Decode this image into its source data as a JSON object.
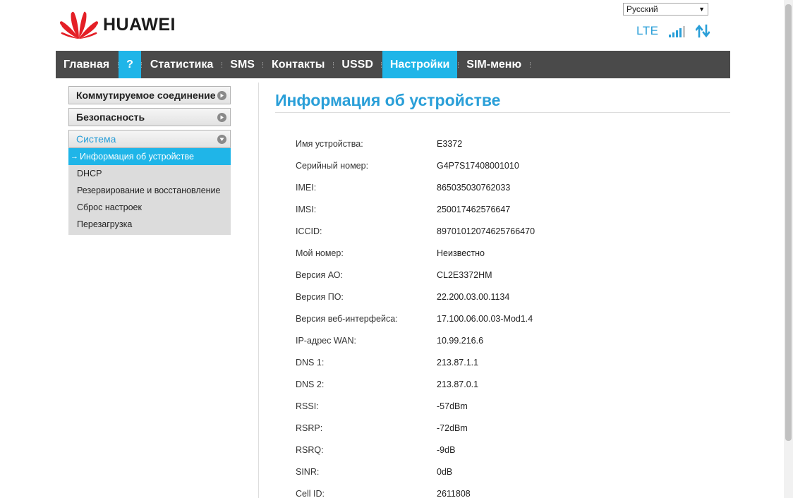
{
  "header": {
    "brand": "HUAWEI",
    "language": "Русский",
    "network": "LTE"
  },
  "nav": [
    {
      "label": "Главная",
      "name": "nav-home",
      "active": false
    },
    {
      "label": "?",
      "name": "nav-help",
      "active": true
    },
    {
      "label": "Статистика",
      "name": "nav-statistics",
      "active": false
    },
    {
      "label": "SMS",
      "name": "nav-sms",
      "active": false
    },
    {
      "label": "Контакты",
      "name": "nav-contacts",
      "active": false
    },
    {
      "label": "USSD",
      "name": "nav-ussd",
      "active": false
    },
    {
      "label": "Настройки",
      "name": "nav-settings",
      "active": true
    },
    {
      "label": "SIM-меню",
      "name": "nav-sim-menu",
      "active": false
    }
  ],
  "sidebar": {
    "sections": [
      {
        "label": "Коммутируемое соединение"
      },
      {
        "label": "Безопасность"
      },
      {
        "label": "Система"
      }
    ],
    "items": [
      {
        "label": "Информация об устройстве",
        "active": true
      },
      {
        "label": "DHCP",
        "active": false
      },
      {
        "label": "Резервирование и восстановление",
        "active": false
      },
      {
        "label": "Сброс настроек",
        "active": false
      },
      {
        "label": "Перезагрузка",
        "active": false
      }
    ],
    "active_marker": "→"
  },
  "main": {
    "title": "Информация об устройстве",
    "rows": [
      {
        "label": "Имя устройства:",
        "value": "E3372"
      },
      {
        "label": "Серийный номер:",
        "value": "G4P7S17408001010"
      },
      {
        "label": "IMEI:",
        "value": "865035030762033"
      },
      {
        "label": "IMSI:",
        "value": "250017462576647"
      },
      {
        "label": "ICCID:",
        "value": "89701012074625766470"
      },
      {
        "label": "Мой номер:",
        "value": "Неизвестно"
      },
      {
        "label": "Версия АО:",
        "value": "CL2E3372HM"
      },
      {
        "label": "Версия ПО:",
        "value": "22.200.03.00.1134"
      },
      {
        "label": "Версия веб-интерфейса:",
        "value": "17.100.06.00.03-Mod1.4"
      },
      {
        "label": "IP-адрес WAN:",
        "value": "10.99.216.6"
      },
      {
        "label": "DNS 1:",
        "value": "213.87.1.1"
      },
      {
        "label": "DNS 2:",
        "value": "213.87.0.1"
      },
      {
        "label": "RSSI:",
        "value": "-57dBm"
      },
      {
        "label": "RSRP:",
        "value": "-72dBm"
      },
      {
        "label": "RSRQ:",
        "value": "-9dB"
      },
      {
        "label": "SINR:",
        "value": "0dB"
      },
      {
        "label": "Cell ID:",
        "value": "2611808"
      }
    ]
  },
  "colors": {
    "accent": "#1fb5e8",
    "title": "#2a9fd8",
    "nav_bg": "#4a4a4a",
    "logo_red": "#e41f26"
  }
}
